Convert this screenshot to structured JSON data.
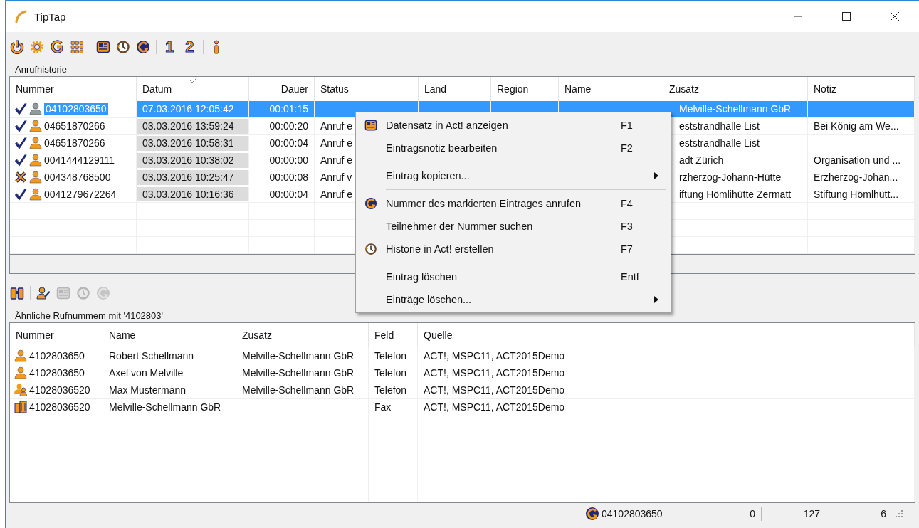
{
  "window": {
    "title": "TipTap"
  },
  "toolbar": [
    {
      "kind": "power"
    },
    {
      "kind": "gear"
    },
    {
      "kind": "redial"
    },
    {
      "kind": "keypad"
    },
    {
      "kind": "separator"
    },
    {
      "kind": "card"
    },
    {
      "kind": "history"
    },
    {
      "kind": "call"
    },
    {
      "kind": "separator"
    },
    {
      "kind": "digit",
      "label": "1"
    },
    {
      "kind": "digit",
      "label": "2"
    },
    {
      "kind": "separator"
    },
    {
      "kind": "info"
    }
  ],
  "history": {
    "title": "Anrufhistorie",
    "columns": [
      {
        "label": "Nummer",
        "sorted": false
      },
      {
        "label": "Datum",
        "sorted": true
      },
      {
        "label": "Dauer",
        "sorted": false
      },
      {
        "label": "Status",
        "sorted": false
      },
      {
        "label": "Land",
        "sorted": false
      },
      {
        "label": "Region",
        "sorted": false
      },
      {
        "label": "Name",
        "sorted": false
      },
      {
        "label": "Zusatz",
        "sorted": false
      },
      {
        "label": "Notiz",
        "sorted": false
      }
    ],
    "rows": [
      {
        "selected": true,
        "kind": "answered",
        "cells": [
          "04102803650",
          "07.03.2016 12:05:42",
          "00:01:15",
          "",
          "",
          "",
          "",
          "Melville-Schellmann GbR",
          ""
        ]
      },
      {
        "selected": false,
        "kind": "answered",
        "cells": [
          "04651870266",
          "03.03.2016 13:59:24",
          "00:00:20",
          "Anruf e",
          "",
          "",
          "",
          "eststrandhalle List",
          "Bei König am We..."
        ]
      },
      {
        "selected": false,
        "kind": "answered",
        "cells": [
          "04651870266",
          "03.03.2016 10:58:31",
          "00:00:04",
          "Anruf e",
          "",
          "",
          "",
          "eststrandhalle List",
          ""
        ]
      },
      {
        "selected": false,
        "kind": "answered",
        "cells": [
          "0041444129111",
          "03.03.2016 10:38:02",
          "00:00:00",
          "Anruf e",
          "",
          "",
          "",
          "adt Zürich",
          "Organisation und ..."
        ]
      },
      {
        "selected": false,
        "kind": "missed",
        "cells": [
          "004348768500",
          "03.03.2016 10:25:47",
          "00:00:08",
          "Anruf v",
          "",
          "",
          "",
          "rzherzog-Johann-Hütte",
          "Erzherzog-Johan..."
        ]
      },
      {
        "selected": false,
        "kind": "answered",
        "cells": [
          "0041279672264",
          "03.03.2016 10:16:36",
          "00:00:04",
          "Anruf e",
          "",
          "",
          "",
          "iftung Hömlihütte Zermatt",
          "Stiftung Hömlhütt..."
        ]
      }
    ]
  },
  "context_menu": [
    {
      "kind": "card",
      "label": "Datensatz in Act! anzeigen",
      "shortcut": "F1",
      "submenu": false
    },
    {
      "kind": "plain",
      "label": "Eintragsnotiz bearbeiten",
      "shortcut": "F2",
      "submenu": false
    },
    {
      "kind": "separator"
    },
    {
      "kind": "plain",
      "label": "Eintrag kopieren...",
      "submenu": true
    },
    {
      "kind": "separator"
    },
    {
      "kind": "call",
      "label": "Nummer des markierten Eintrages anrufen",
      "shortcut": "F4",
      "submenu": false
    },
    {
      "kind": "plain",
      "label": "Teilnehmer der Nummer suchen",
      "shortcut": "F3",
      "submenu": false
    },
    {
      "kind": "history",
      "label": "Historie in Act! erstellen",
      "shortcut": "F7",
      "submenu": false
    },
    {
      "kind": "separator"
    },
    {
      "kind": "plain",
      "label": "Eintrag löschen",
      "shortcut": "Entf",
      "submenu": false
    },
    {
      "kind": "plain",
      "label": "Einträge löschen...",
      "submenu": true
    }
  ],
  "lower_toolbar": [
    {
      "kind": "binoculars",
      "disabled": false
    },
    {
      "kind": "separator"
    },
    {
      "kind": "person-edit",
      "disabled": false
    },
    {
      "kind": "card",
      "disabled": true
    },
    {
      "kind": "history",
      "disabled": true
    },
    {
      "kind": "call",
      "disabled": true
    }
  ],
  "similar": {
    "title": "Ähnliche Rufnummem mit '4102803'",
    "columns": [
      "Nummer",
      "Name",
      "Zusatz",
      "Feld",
      "Quelle"
    ],
    "rows": [
      {
        "kind": "person",
        "cells": [
          "4102803650",
          "Robert Schellmann",
          "Melville-Schellmann GbR",
          "Telefon",
          "ACT!, MSPC11, ACT2015Demo"
        ]
      },
      {
        "kind": "person",
        "cells": [
          "4102803650",
          "Axel von Melville",
          "Melville-Schellmann GbR",
          "Telefon",
          "ACT!, MSPC11, ACT2015Demo"
        ]
      },
      {
        "kind": "persons",
        "cells": [
          "41028036520",
          "Max Mustermann",
          "Melville-Schellmann GbR",
          "Telefon",
          "ACT!, MSPC11, ACT2015Demo"
        ]
      },
      {
        "kind": "company",
        "cells": [
          "41028036520",
          "Melville-Schellmann GbR",
          "",
          "Fax",
          "ACT!, MSPC11, ACT2015Demo"
        ]
      }
    ]
  },
  "status_bar": {
    "number": "04102803650",
    "field_1": "0",
    "field_2": "127",
    "field_3": "6"
  }
}
